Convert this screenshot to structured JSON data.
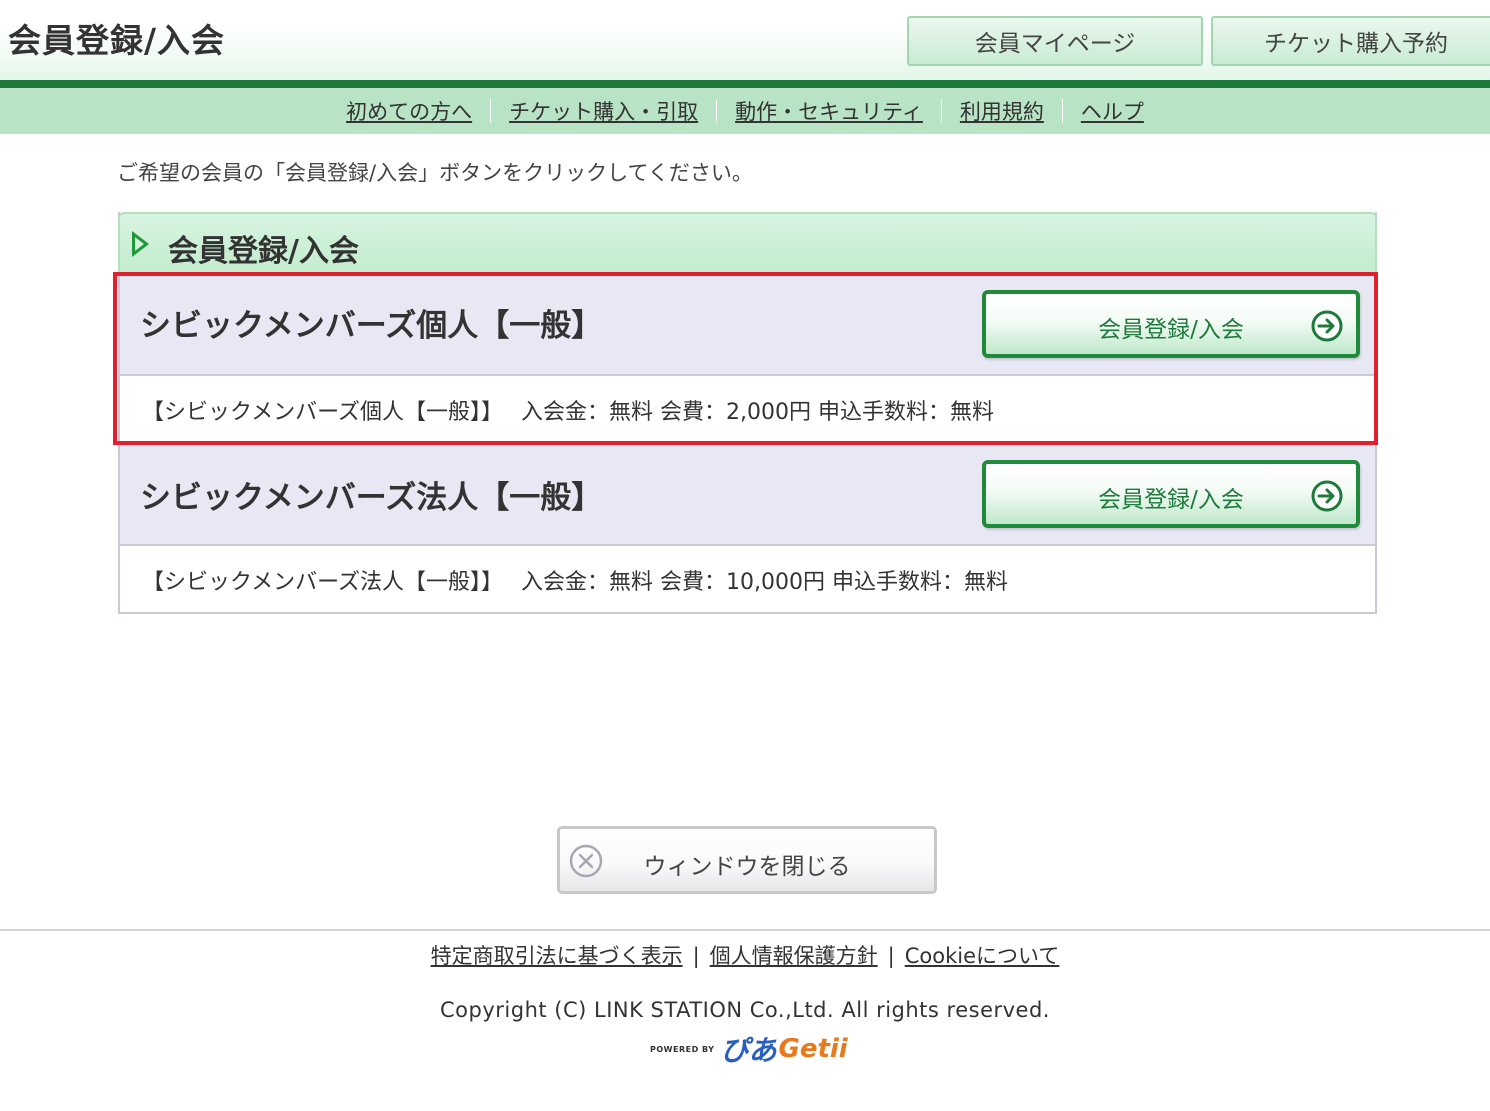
{
  "header": {
    "title": "会員登録/入会",
    "buttons": {
      "mypage": "会員マイページ",
      "ticket": "チケット購入予約"
    }
  },
  "nav": {
    "items": [
      "初めての方へ",
      "チケット購入・引取",
      "動作・セキュリティ",
      "利用規約",
      "ヘルプ"
    ]
  },
  "instruction": "ご希望の会員の「会員登録/入会」ボタンをクリックしてください。",
  "section": {
    "title": "会員登録/入会",
    "plans": [
      {
        "name": "シビックメンバーズ個人【一般】",
        "button_label": "会員登録/入会",
        "description": "【シビックメンバーズ個人【一般】】　 入会金：無料 会費：2,000円 申込手数料：無料",
        "highlighted": true
      },
      {
        "name": "シビックメンバーズ法人【一般】",
        "button_label": "会員登録/入会",
        "description": "【シビックメンバーズ法人【一般】】　 入会金：無料 会費：10,000円 申込手数料：無料",
        "highlighted": false
      }
    ]
  },
  "close_button": "ウィンドウを閉じる",
  "footer": {
    "links": [
      "特定商取引法に基づく表示",
      "個人情報保護方針",
      "Cookieについて"
    ],
    "copyright": "Copyright (C) LINK STATION Co.,Ltd. All rights reserved.",
    "logo": {
      "powered": "POWERED BY",
      "pia": "ぴあ",
      "getii": "Getii"
    }
  },
  "colors": {
    "accent_green": "#1e7a3a",
    "nav_bg": "#b8e3c4",
    "highlight_red": "#e0202e"
  }
}
